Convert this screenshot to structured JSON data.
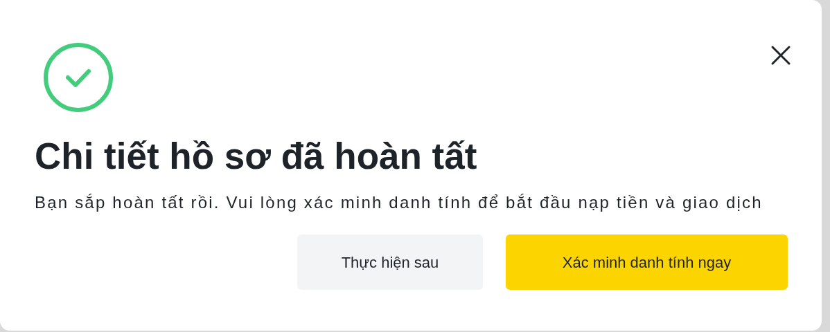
{
  "dialog": {
    "title": "Chi tiết hồ sơ đã hoàn tất",
    "message": "Bạn sắp hoàn tất rồi. Vui lòng xác minh danh tính để bắt đầu nạp tiền và giao dịch",
    "completed": true,
    "buttons": [
      {
        "label": "Thực hiện sau",
        "kind": "secondary"
      },
      {
        "label": "Xác minh danh tính ngay",
        "kind": "primary"
      }
    ]
  }
}
